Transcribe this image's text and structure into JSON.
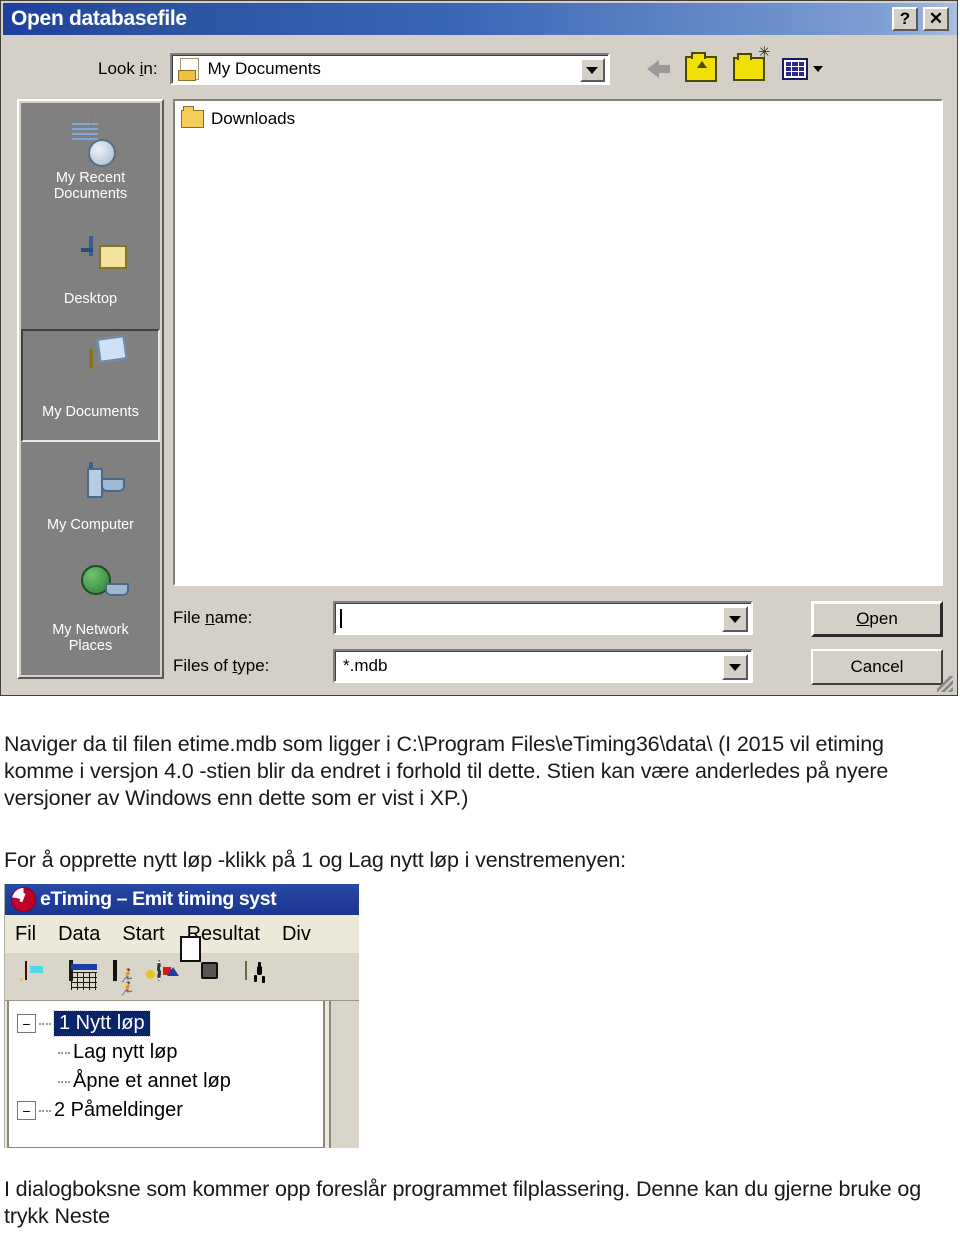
{
  "dialog": {
    "title": "Open databasefile",
    "help_button": "?",
    "close_button": "✕",
    "look_in": {
      "label_pre": "Look ",
      "label_underline": "i",
      "label_post": "n:",
      "value": "My Documents"
    },
    "toolbar": {
      "back": "back-arrow",
      "up": "up-one-level",
      "new_folder": "create-new-folder",
      "views": "views-menu"
    },
    "places": [
      {
        "label": "My Recent\nDocuments",
        "icon": "recent-documents-icon",
        "selected": false
      },
      {
        "label": "Desktop",
        "icon": "desktop-icon",
        "selected": false
      },
      {
        "label": "My Documents",
        "icon": "my-documents-icon",
        "selected": true
      },
      {
        "label": "My Computer",
        "icon": "my-computer-icon",
        "selected": false
      },
      {
        "label": "My Network\nPlaces",
        "icon": "network-places-icon",
        "selected": false
      }
    ],
    "files": [
      {
        "name": "Downloads",
        "type": "folder"
      }
    ],
    "file_name": {
      "label_pre": "File ",
      "label_underline": "n",
      "label_post": "ame:",
      "value": ""
    },
    "files_of_type": {
      "label_pre": "Files of ",
      "label_underline": "t",
      "label_post": "ype:",
      "value": "*.mdb"
    },
    "buttons": {
      "open_pre": "",
      "open_underline": "O",
      "open_post": "pen",
      "cancel": "Cancel"
    }
  },
  "body": {
    "paragraph1": "Naviger da til filen etime.mdb som ligger i C:\\Program Files\\eTiming36\\data\\ (I 2015 vil etiming komme i versjon 4.0 -stien blir da endret i forhold til dette. Stien kan være anderledes på nyere versjoner av Windows enn dette som er vist i XP.)",
    "paragraph2": "For å opprette nytt løp -klikk på 1 og Lag nytt løp i venstremenyen:",
    "paragraph3": "I dialogboksne som kommer opp foreslår programmet filplassering. Denne kan du gjerne bruke og trykk Neste"
  },
  "etiming": {
    "title": "eTiming – Emit timing syst",
    "logo": "etiming-logo-icon",
    "menu": [
      "Fil",
      "Data",
      "Start",
      "Resultat",
      "Div"
    ],
    "toolbar_icons": [
      "exit-door-icon",
      "spreadsheet-icon",
      "runners-film-icon",
      "target-shapes-icon",
      "club-building-icon",
      "walking-person-icon",
      "blue-circle-icon"
    ],
    "tree": [
      {
        "expander": "−",
        "label": "1 Nytt løp",
        "level": 0,
        "selected": true
      },
      {
        "expander": "",
        "label": "Lag nytt løp",
        "level": 1,
        "selected": false
      },
      {
        "expander": "",
        "label": "Åpne et annet løp",
        "level": 1,
        "selected": false
      },
      {
        "expander": "−",
        "label": "2 Påmeldinger",
        "level": 0,
        "selected": false
      }
    ]
  }
}
